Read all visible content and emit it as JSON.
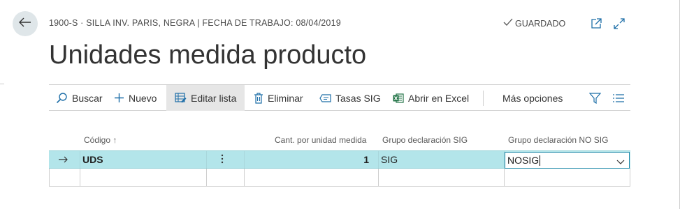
{
  "header": {
    "breadcrumb": "1900-S · SILLA INV. PARIS, NEGRA | FECHA DE TRABAJO: 08/04/2019",
    "status": "GUARDADO",
    "title": "Unidades medida producto"
  },
  "actions": {
    "search": "Buscar",
    "new": "Nuevo",
    "edit_list": "Editar lista",
    "delete": "Eliminar",
    "sig_rates": "Tasas SIG",
    "open_excel": "Abrir en Excel",
    "more": "Más opciones"
  },
  "columns": {
    "code": "Código",
    "sort_indicator": "↑",
    "qty_per_unit": "Cant. por unidad medida",
    "sig_group": "Grupo declaración SIG",
    "nosig_group": "Grupo declaración NO SIG"
  },
  "rows": [
    {
      "code": "UDS",
      "qty": "1",
      "sig_group": "SIG",
      "nosig_group": "NOSIG"
    }
  ],
  "colors": {
    "selected_row": "#b3e5ea",
    "accent": "#1e88a8",
    "excel_green": "#217346"
  },
  "icons": {
    "back": "arrow-left-icon",
    "saved": "checkmark-icon",
    "popout": "open-new-window-icon",
    "expand": "expand-icon",
    "search": "search-icon",
    "new": "plus-icon",
    "edit_list": "edit-list-icon",
    "delete": "trash-icon",
    "sig": "tag-icon",
    "excel": "excel-icon",
    "filter": "filter-icon",
    "list": "list-view-icon",
    "row_arrow": "row-arrow-icon",
    "row_menu": "vertical-ellipsis-icon",
    "dropdown": "chevron-down-icon"
  }
}
